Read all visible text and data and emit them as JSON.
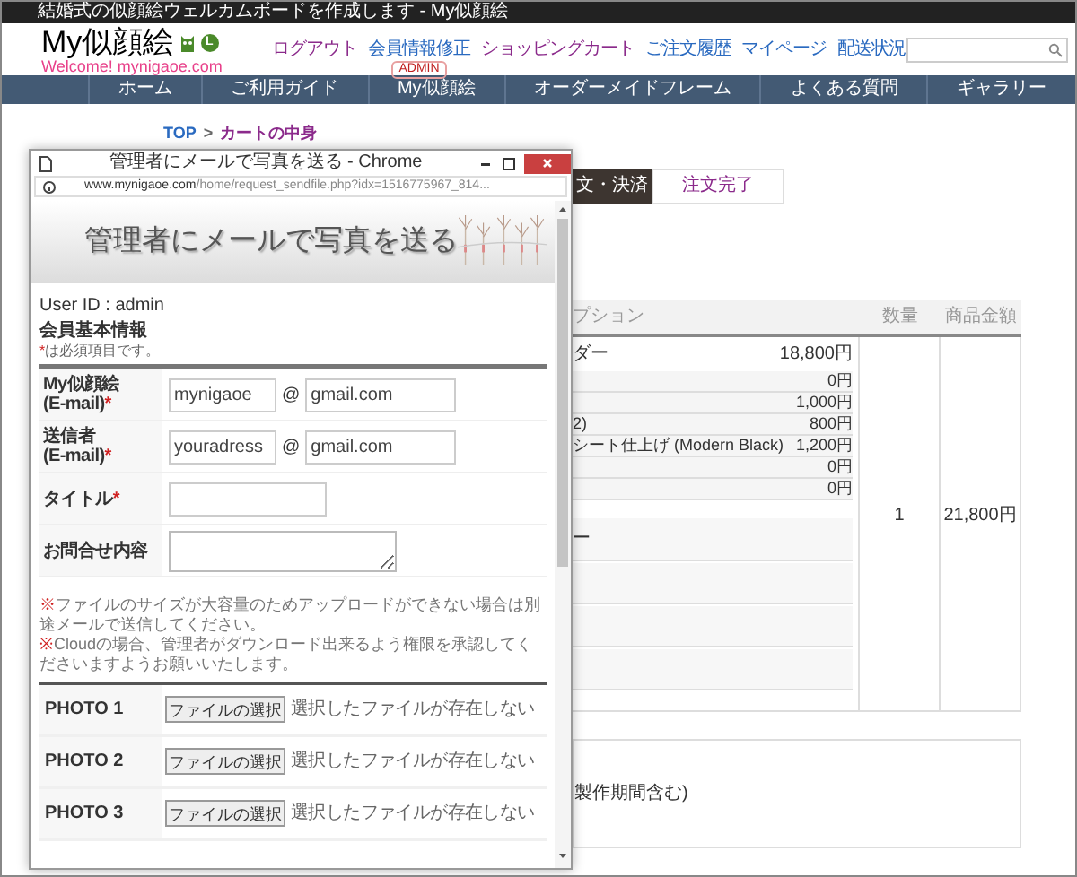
{
  "top_bar": {
    "title": "結婚式の似顔絵ウェルカムボードを作成します - My似顔絵"
  },
  "header": {
    "logo": "My似顔絵",
    "logo_badge": "L",
    "tagline": "Welcome! mynigaoe.com",
    "links": [
      {
        "label": "ログアウト",
        "visited": true
      },
      {
        "label": "会員情報修正",
        "visited": false,
        "badge": "ADMIN"
      },
      {
        "label": "ショッピングカート",
        "visited": true
      },
      {
        "label": "ご注文履歴",
        "visited": false
      },
      {
        "label": "マイページ",
        "visited": false
      },
      {
        "label": "配送状況",
        "visited": false
      }
    ]
  },
  "nav": [
    "ホーム",
    "ご利用ガイド",
    "My似顔絵",
    "オーダーメイドフレーム",
    "よくある質問",
    "ギャラリー"
  ],
  "breadcrumb": {
    "items": [
      "TOP",
      "カートの中身"
    ],
    "separator": ">"
  },
  "steps": [
    {
      "label": "文・決済",
      "selected": true
    },
    {
      "label": "注文完了",
      "selected": false
    }
  ],
  "cart_table": {
    "columns": [
      "プション",
      "数量",
      "商品金額"
    ],
    "item": {
      "name": "ダー",
      "price": "18,800円"
    },
    "options": [
      {
        "price": "0円"
      },
      {
        "price": "1,000円"
      },
      {
        "name": "2)",
        "price": "800円"
      },
      {
        "name": "シート仕上げ (Modern Black)",
        "price": "1,200円"
      },
      {
        "price": "0円"
      },
      {
        "price": "0円"
      }
    ],
    "extra": "ー",
    "quantity": "1",
    "total": "21,800円"
  },
  "delivery_box": {
    "text": "製作期間含む)"
  },
  "popup": {
    "title": "管理者にメールで写真を送る - Chrome",
    "url_domain": "www.mynigaoe.com",
    "url_path": "/home/request_sendfile.php?idx=1516775967_814...",
    "banner": "管理者にメールで写真を送る",
    "user_id": "User ID : admin",
    "section_title": "会員基本情報",
    "required_mark": "*",
    "required_note": "は必須項目です。",
    "fields": [
      {
        "kind": "email",
        "label": [
          "My似顔絵",
          "(E-mail)"
        ],
        "required": true,
        "local": "mynigaoe",
        "at": "@",
        "domain": "gmail.com"
      },
      {
        "kind": "email",
        "label": [
          "送信者",
          "(E-mail)"
        ],
        "required": true,
        "local": "youradress",
        "at": "@",
        "domain": "gmail.com"
      },
      {
        "kind": "text",
        "label": [
          "タイトル"
        ],
        "required": true
      },
      {
        "kind": "textarea",
        "label": [
          "お問合せ内容"
        ],
        "required": false
      }
    ],
    "notes": [
      {
        "mark": "※",
        "text": "ファイルのサイズが大容量のためアップロードができない場合は別途メールで送信してください。"
      },
      {
        "mark": "※",
        "text": "Cloudの場合、管理者がダウンロード出来るよう権限を承認してくださいますようお願いいたします。"
      }
    ],
    "photos": [
      {
        "label": "PHOTO 1",
        "button": "ファイルの選択",
        "status": "選択したファイルが存在しない"
      },
      {
        "label": "PHOTO 2",
        "button": "ファイルの選択",
        "status": "選択したファイルが存在しない"
      },
      {
        "label": "PHOTO 3",
        "button": "ファイルの選択",
        "status": "選択したファイルが存在しない"
      }
    ]
  }
}
